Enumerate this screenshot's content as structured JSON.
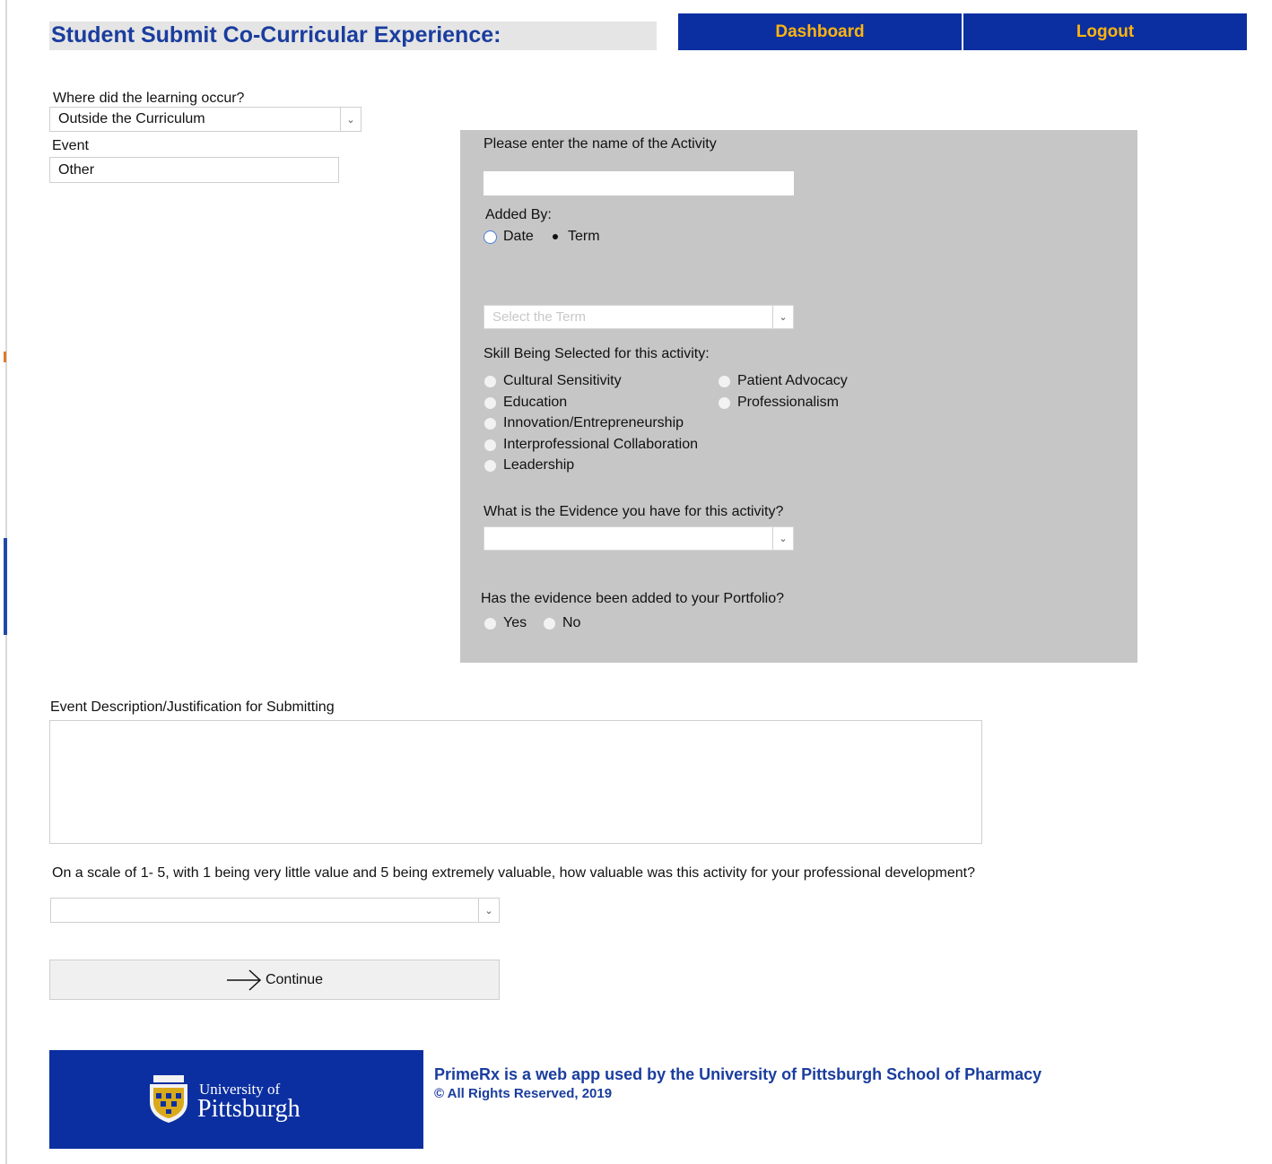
{
  "header": {
    "title": "Student Submit Co-Curricular Experience:",
    "nav": {
      "dashboard": "Dashboard",
      "logout": "Logout"
    }
  },
  "form": {
    "learning_label": "Where did the learning occur?",
    "learning_value": "Outside the Curriculum",
    "event_label": "Event",
    "event_value": "Other",
    "panel": {
      "activity_label": "Please enter the name of the Activity",
      "activity_value": "",
      "added_by_label": "Added By:",
      "added_by_options": [
        "Date",
        "Term"
      ],
      "added_by_selected": "Term",
      "term_placeholder": "Select the Term",
      "skill_label": "Skill Being Selected  for this activity:",
      "skills_col1": [
        "Cultural Sensitivity",
        "Education",
        "Innovation/Entrepreneurship",
        "Interprofessional Collaboration",
        "Leadership"
      ],
      "skills_col2": [
        "Patient Advocacy",
        "Professionalism"
      ],
      "evidence_label": "What is the Evidence you have for this activity?",
      "evidence_value": "",
      "portfolio_label": "Has the evidence been added to your Portfolio?",
      "portfolio_options": [
        "Yes",
        "No"
      ]
    },
    "description_label": "Event Description/Justification for Submitting",
    "description_value": "",
    "scale_label": "On a scale of 1- 5, with 1 being very little value and 5 being extremely valuable, how valuable was this activity for your professional development?",
    "scale_value": "",
    "continue_label": "Continue"
  },
  "footer": {
    "logo_line1": "University of",
    "logo_line2": "Pittsburgh",
    "text1": "PrimeRx is a web app used by the University of Pittsburgh School of Pharmacy",
    "text2": "© All Rights Reserved, 2019"
  },
  "colors": {
    "brand_blue": "#0b2fa0",
    "brand_gold": "#ffb40f",
    "title_blue": "#1a3d9e",
    "panel_gray": "#c6c6c6"
  }
}
